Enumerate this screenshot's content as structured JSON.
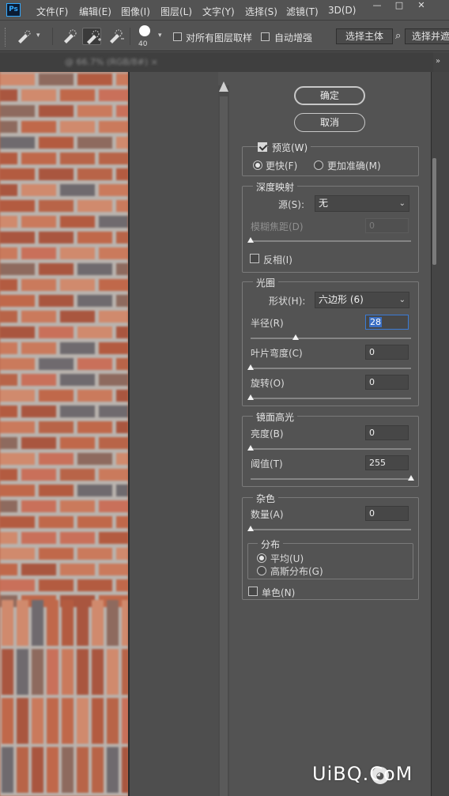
{
  "app": {
    "logo": "Ps"
  },
  "menu": {
    "items": [
      "文件(F)",
      "编辑(E)",
      "图像(I)",
      "图层(L)",
      "文字(Y)",
      "选择(S)",
      "滤镜(T)",
      "3D(D)"
    ]
  },
  "window_controls": {
    "minimize": "—",
    "maximize": "□",
    "close": "✕"
  },
  "options_bar": {
    "tool_icons": [
      "quick-selection-brush-icon",
      "new-selection-icon",
      "add-to-selection-icon",
      "subtract-from-selection-icon"
    ],
    "brush_size": "40",
    "sample_all_layers_label": "对所有图层取样",
    "sample_all_layers_checked": false,
    "auto_enhance_label": "自动增强",
    "auto_enhance_checked": false,
    "select_subject_label": "选择主体",
    "select_and_mask_label": "选择并遮"
  },
  "document": {
    "tab_title": "@ 66.7% (RGB/8#) ×"
  },
  "lens_blur": {
    "ok_label": "确定",
    "cancel_label": "取消",
    "preview": {
      "label": "预览(W)",
      "checked": true,
      "faster_label": "更快(F)",
      "more_accurate_label": "更加准确(M)",
      "selected": "faster"
    },
    "depth_map": {
      "title": "深度映射",
      "source_label": "源(S):",
      "source_value": "无",
      "blur_focal_distance_label": "模糊焦距(D)",
      "blur_focal_distance_value": "0",
      "blur_focal_distance_slider": 0,
      "invert_label": "反相(I)",
      "invert_checked": false
    },
    "iris": {
      "title": "光圈",
      "shape_label": "形状(H):",
      "shape_value": "六边形 (6)",
      "radius_label": "半径(R)",
      "radius_value": "28",
      "radius_slider": 28,
      "blade_curvature_label": "叶片弯度(C)",
      "blade_curvature_value": "0",
      "blade_curvature_slider": 0,
      "rotation_label": "旋转(O)",
      "rotation_value": "0",
      "rotation_slider": 0
    },
    "specular_highlights": {
      "title": "镜面高光",
      "brightness_label": "亮度(B)",
      "brightness_value": "0",
      "brightness_slider": 0,
      "threshold_label": "阈值(T)",
      "threshold_value": "255",
      "threshold_slider": 255
    },
    "noise": {
      "title": "杂色",
      "amount_label": "数量(A)",
      "amount_value": "0",
      "amount_slider": 0,
      "distribution_title": "分布",
      "uniform_label": "平均(U)",
      "gaussian_label": "高斯分布(G)",
      "distribution_selected": "uniform",
      "monochromatic_label": "单色(N)",
      "monochromatic_checked": false
    }
  },
  "watermark": {
    "text": "UiBQ.CoM",
    "icon": "wechat-icon"
  },
  "colors": {
    "panel_bg": "#535353",
    "accent": "#3a7bd5",
    "brick": "#b96a4f"
  }
}
